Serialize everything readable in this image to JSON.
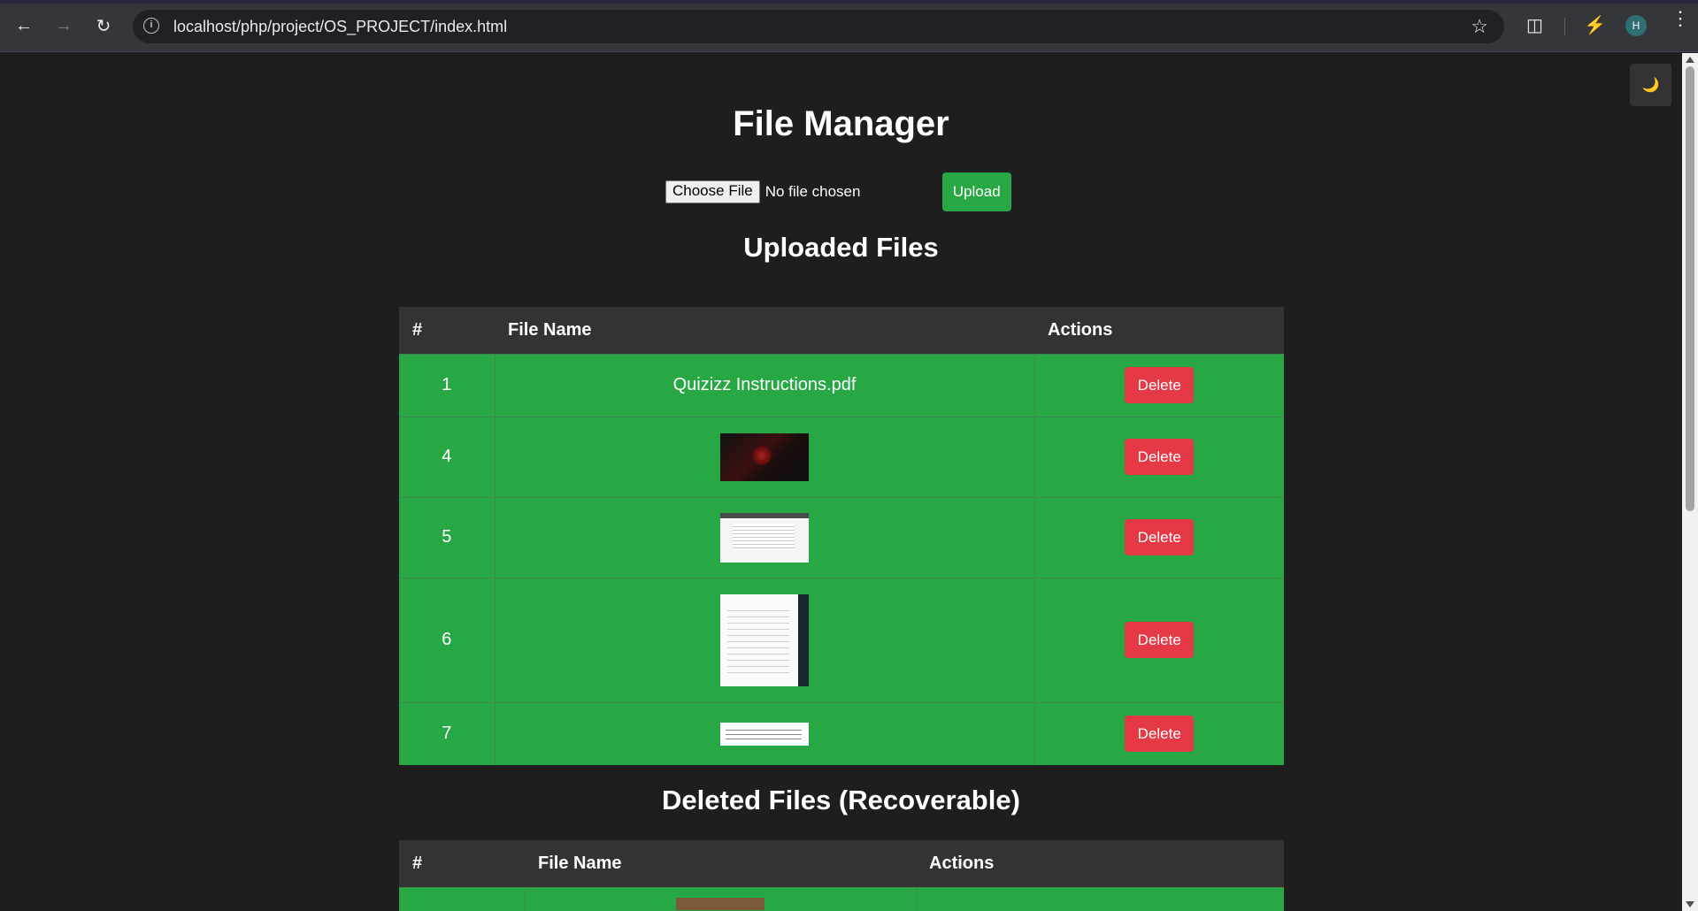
{
  "browser": {
    "url": "localhost/php/project/OS_PROJECT/index.html",
    "avatar_letter": "H"
  },
  "theme_toggle": {
    "icon": "moon-icon",
    "glyph": "🌙"
  },
  "page": {
    "title": "File Manager",
    "choose_file_label": "Choose File",
    "no_file_text": "No file chosen",
    "upload_label": "Upload"
  },
  "uploaded": {
    "heading": "Uploaded Files",
    "columns": [
      "#",
      "File Name",
      "Actions"
    ],
    "rows": [
      {
        "num": "1",
        "file_name": "Quizizz Instructions.pdf",
        "action": "Delete"
      },
      {
        "num": "4",
        "file_name": "",
        "thumbnail": "dark-image-thumbnail",
        "action": "Delete"
      },
      {
        "num": "5",
        "file_name": "",
        "thumbnail": "screenshot-thumbnail",
        "action": "Delete"
      },
      {
        "num": "6",
        "file_name": "",
        "thumbnail": "document-thumbnail",
        "action": "Delete"
      },
      {
        "num": "7",
        "file_name": "",
        "thumbnail": "text-thumbnail",
        "action": "Delete"
      }
    ]
  },
  "deleted": {
    "heading": "Deleted Files (Recoverable)",
    "columns": [
      "#",
      "File Name",
      "Actions"
    ]
  },
  "colors": {
    "background": "#1e1e1e",
    "row_green": "#28a745",
    "header_gray": "#333333",
    "delete_red": "#e63946"
  }
}
